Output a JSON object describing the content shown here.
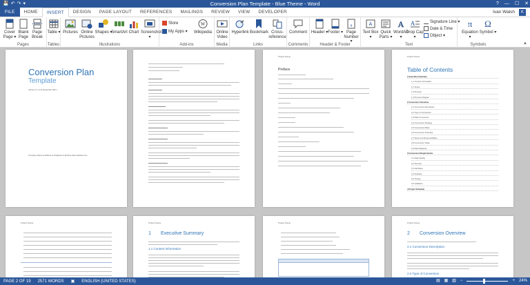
{
  "window": {
    "title": "Conversion Plan Template - Blue Theme - Word",
    "help": "?",
    "minimize": "—",
    "maximize": "☐",
    "close": "✕"
  },
  "qat": {
    "save": "💾",
    "undo": "↶",
    "redo": "↷",
    "more": "▾"
  },
  "tabs": [
    "FILE",
    "HOME",
    "INSERT",
    "DESIGN",
    "PAGE LAYOUT",
    "REFERENCES",
    "MAILINGS",
    "REVIEW",
    "VIEW",
    "DEVELOPER"
  ],
  "active_tab": "INSERT",
  "user": {
    "name": "Ivan Walsh",
    "initial": "K"
  },
  "ribbon": {
    "groups": {
      "pages": "Pages",
      "tables": "Tables",
      "illustrations": "Illustrations",
      "addins": "Add-ins",
      "media": "Media",
      "links": "Links",
      "comments": "Comments",
      "header_footer": "Header & Footer",
      "text": "Text",
      "symbols": "Symbols"
    },
    "buttons": {
      "cover_page": "Cover Page ▾",
      "blank_page": "Blank Page",
      "page_break": "Page Break",
      "table": "Table ▾",
      "pictures": "Pictures",
      "online_pictures": "Online Pictures",
      "shapes": "Shapes ▾",
      "smartart": "SmartArt",
      "chart": "Chart",
      "screenshot": "Screenshot ▾",
      "store": "Store",
      "my_apps": "My Apps ▾",
      "wikipedia": "Wikipedia",
      "online_video": "Online Video",
      "hyperlink": "Hyperlink",
      "bookmark": "Bookmark",
      "cross_reference": "Cross-reference",
      "comment": "Comment",
      "header": "Header ▾",
      "footer": "Footer ▾",
      "page_number": "Page Number ▾",
      "text_box": "Text Box ▾",
      "quick_parts": "Quick Parts ▾",
      "wordart": "WordArt ▾",
      "drop_cap": "Drop Cap ▾",
      "signature_line": "Signature Line ▾",
      "date_time": "Date & Time",
      "object": "Object ▾",
      "equation": "Equation ▾",
      "symbol": "Symbol ▾"
    },
    "collapse": "▲"
  },
  "doc": {
    "cover_title": "Conversion Plan",
    "cover_subtitle": "Template",
    "cover_version": "Version X.x ● 3x December 20X x",
    "cover_footer": "Company Name ● Address ● Telephone ● Email ● www.website.com",
    "preface": "Preface",
    "toc": "Table of Contents",
    "exec_num": "1",
    "exec_title": "Executive Summary",
    "exec_sub": "1.1      Content Information",
    "conv_num": "2",
    "conv_title": "Conversion Overview",
    "conv_sub": "2.1      Conversion Description",
    "conv_sub2": "2.2      Type of Conversion",
    "proj_name": "Project Name"
  },
  "toc_items": [
    "1   Executive Summary",
    "1.1   Content Information",
    "1.2   Scope",
    "1.3   Purpose",
    "1.4   Process Diagram",
    "2   Conversion Overview",
    "2.1   Conversion Description",
    "2.2   Type of Conversion",
    "2.3   Data Conversion",
    "2.4   Conversion Strategy",
    "2.5   Conversion Risks",
    "2.6   Conversion Schedule",
    "2.7   Roles and Responsibilities",
    "2.8   Conversion Tasks",
    "2.9   Data Mapping",
    "3   Conversion Requirements",
    "3.1   Data Quality",
    "3.2   Security",
    "3.3   Hardware",
    "3.4   Software",
    "3.5   Testing",
    "3.6   Validation",
    "4   Project Schedule"
  ],
  "status": {
    "page": "PAGE 2 OF 19",
    "words": "2571 WORDS",
    "language": "ENGLISH (UNITED STATES)",
    "zoom": "24%"
  }
}
